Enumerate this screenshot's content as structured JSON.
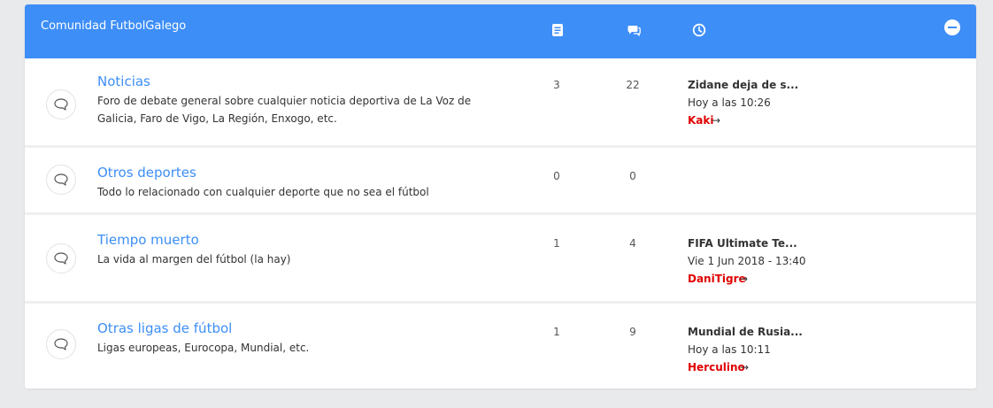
{
  "category": {
    "title": "Comunidad FutbolGalego",
    "columns": {
      "topics_icon": "document-icon",
      "posts_icon": "chat-icon",
      "last_post_icon": "clock-icon"
    }
  },
  "colors": {
    "header": "#3d8ef7",
    "forum_title": "#3d8ef7",
    "username": "#e00000"
  },
  "forums": [
    {
      "title": "Noticias",
      "description": "Foro de debate general sobre cualquier noticia deportiva de La Voz de Galicia, Faro de Vigo, La Región, Enxogo, etc.",
      "topics": "3",
      "posts": "22",
      "last_post": {
        "title": "Zidane deja de s...",
        "time": "Hoy a las 10:26",
        "user": "Kaki",
        "arrow": "→"
      }
    },
    {
      "title": "Otros deportes",
      "description": "Todo lo relacionado con cualquier deporte que no sea el fútbol",
      "topics": "0",
      "posts": "0"
    },
    {
      "title": "Tiempo muerto",
      "description": "La vida al margen del fútbol (la hay)",
      "topics": "1",
      "posts": "4",
      "last_post": {
        "title": "FIFA Ultimate Te...",
        "time": "Vie 1 Jun 2018 - 13:40",
        "user": "DaniTigre",
        "arrow": "→"
      }
    },
    {
      "title": "Otras ligas de fútbol",
      "description": "Ligas europeas, Eurocopa, Mundial, etc.",
      "topics": "1",
      "posts": "9",
      "last_post": {
        "title": "Mundial de Rusia...",
        "time": "Hoy a las 10:11",
        "user": "Herculino",
        "arrow": "→"
      }
    }
  ]
}
